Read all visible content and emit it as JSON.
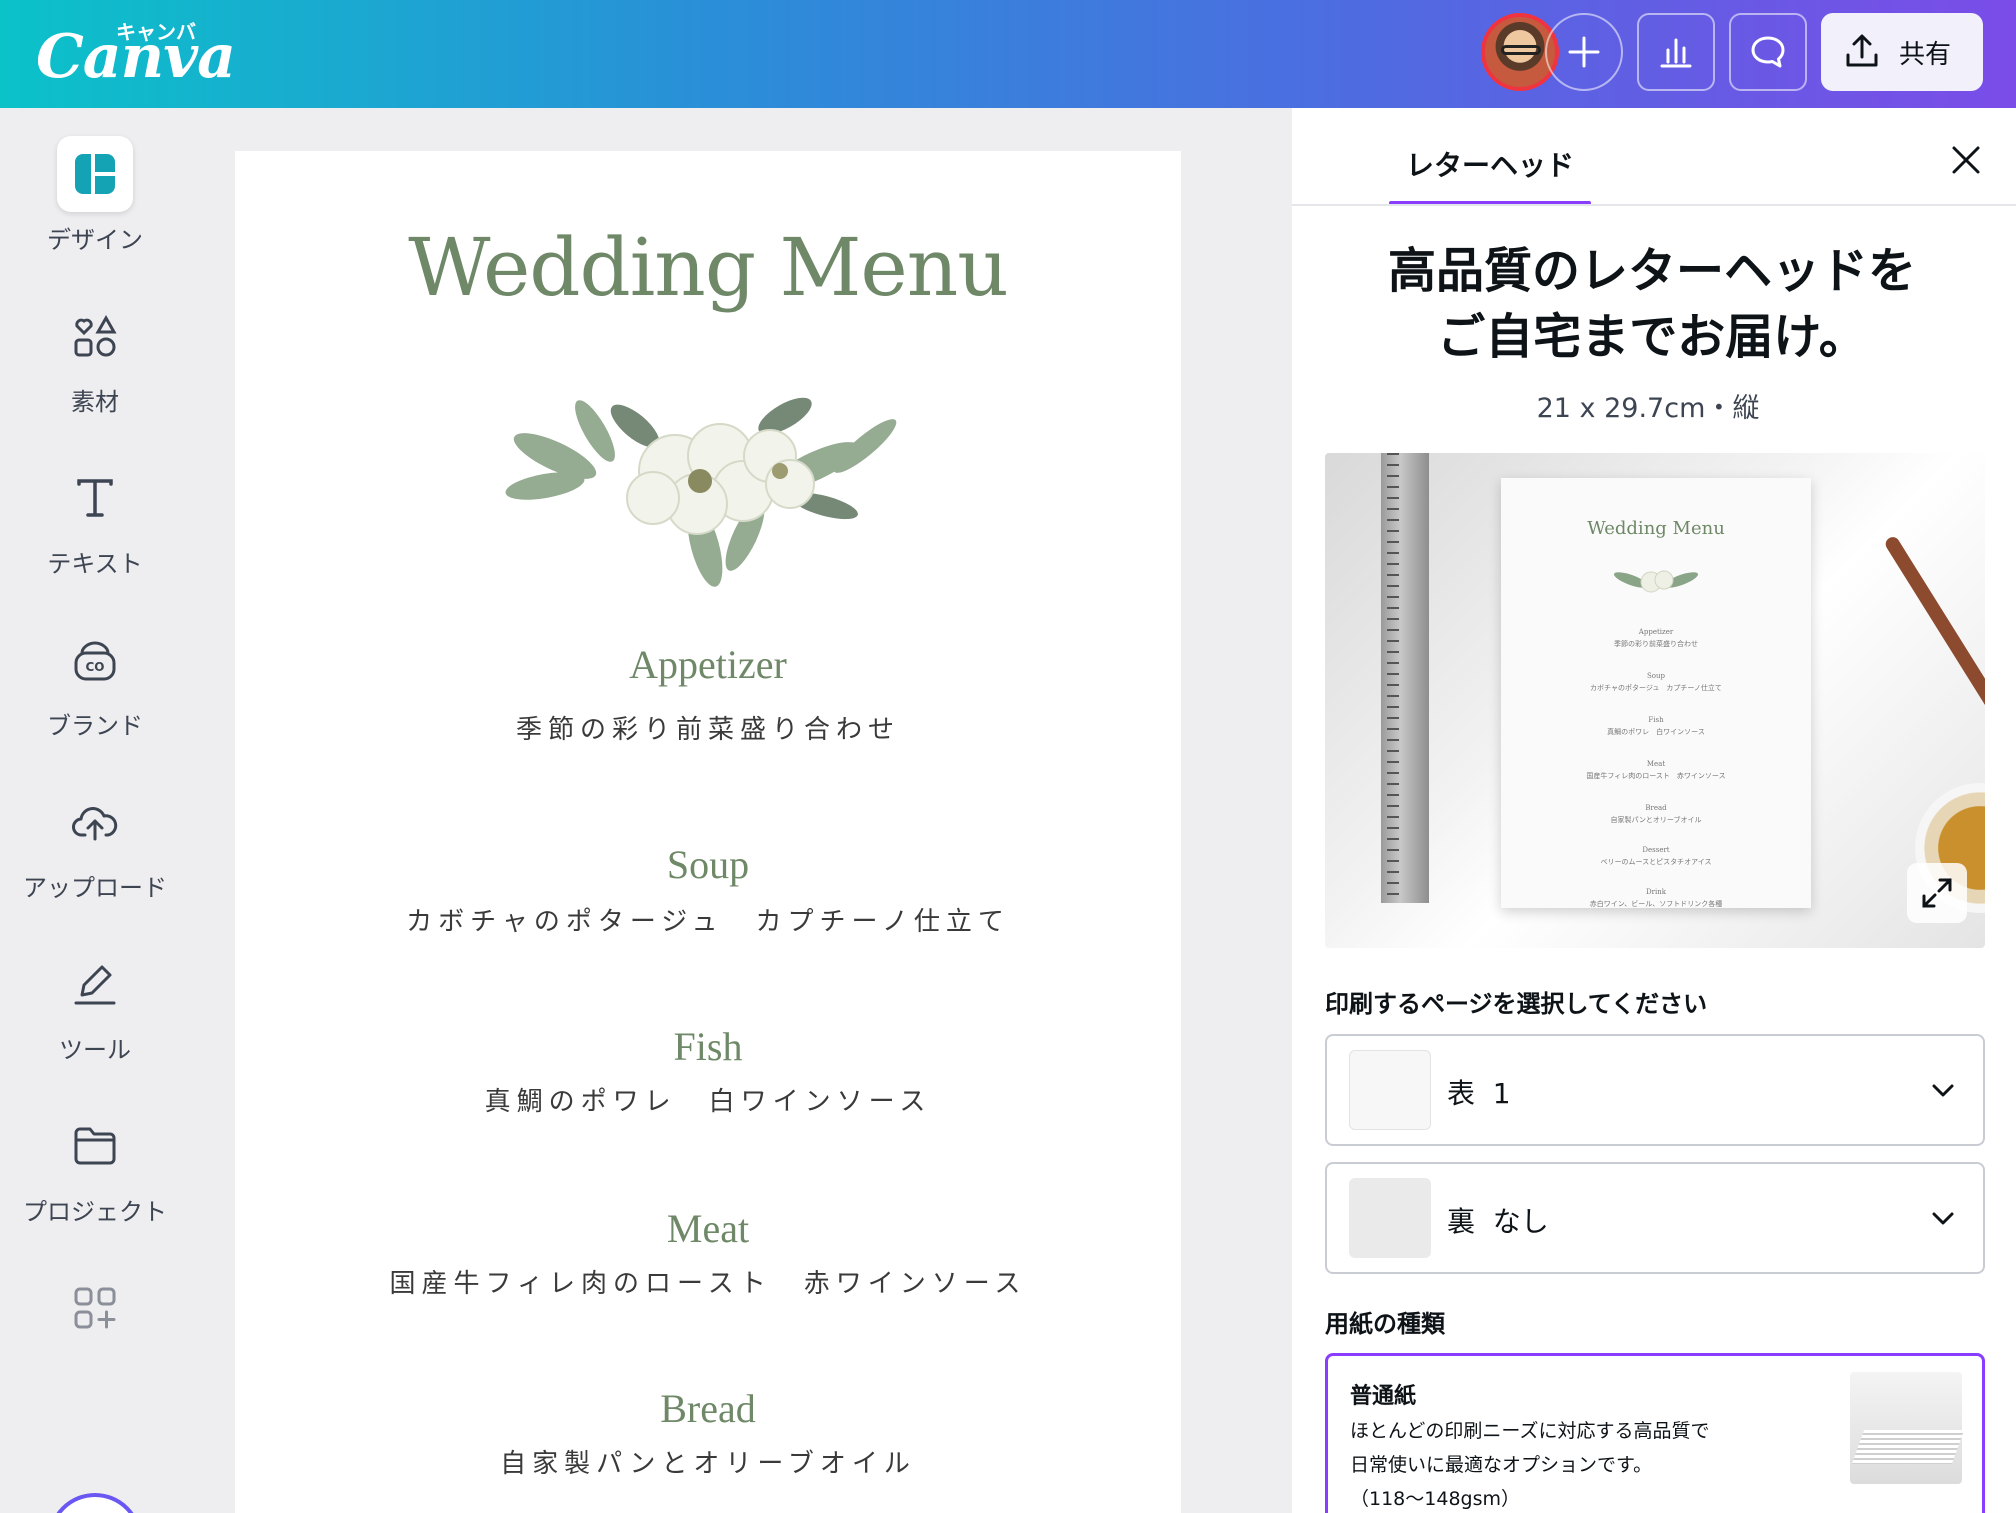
{
  "header": {
    "logo_text": "Canva",
    "logo_kana": "キャンバ",
    "share_label": "共有"
  },
  "sidebar": {
    "items": [
      {
        "label": "デザイン",
        "icon": "design-icon"
      },
      {
        "label": "素材",
        "icon": "elements-icon"
      },
      {
        "label": "テキスト",
        "icon": "text-icon"
      },
      {
        "label": "ブランド",
        "icon": "brand-icon"
      },
      {
        "label": "アップロード",
        "icon": "upload-icon"
      },
      {
        "label": "ツール",
        "icon": "tools-icon"
      },
      {
        "label": "プロジェクト",
        "icon": "projects-icon"
      },
      {
        "label": "",
        "icon": "apps-icon"
      }
    ]
  },
  "document": {
    "title": "Wedding Menu",
    "courses": [
      {
        "name": "Appetizer",
        "desc": "季節の彩り前菜盛り合わせ"
      },
      {
        "name": "Soup",
        "desc": "カボチャのポタージュ　カプチーノ仕立て"
      },
      {
        "name": "Fish",
        "desc": "真鯛のポワレ　白ワインソース"
      },
      {
        "name": "Meat",
        "desc": "国産牛フィレ肉のロースト　赤ワインソース"
      },
      {
        "name": "Bread",
        "desc": "自家製パンとオリーブオイル"
      }
    ]
  },
  "panel": {
    "tab_label": "レターヘッド",
    "headline_line1": "高品質のレターヘッドを",
    "headline_line2": "ご自宅までお届け。",
    "dimensions": "21 x 29.7cm・縦",
    "preview": {
      "title": "Wedding Menu",
      "rows": [
        {
          "name": "Appetizer",
          "desc": "季節の彩り前菜盛り合わせ"
        },
        {
          "name": "Soup",
          "desc": "カボチャのポタージュ　カプチーノ仕立て"
        },
        {
          "name": "Fish",
          "desc": "真鯛のポワレ　白ワインソース"
        },
        {
          "name": "Meat",
          "desc": "国産牛フィレ肉のロースト　赤ワインソース"
        },
        {
          "name": "Bread",
          "desc": "自家製パンとオリーブオイル"
        },
        {
          "name": "Dessert",
          "desc": "ベリーのムースとピスタチオアイス"
        },
        {
          "name": "Drink",
          "desc": "赤白ワイン、ビール、ソフトドリンク各種"
        }
      ]
    },
    "pages_label": "印刷するページを選択してください",
    "front_select": "表  1",
    "back_select": "裏  なし",
    "paper_label": "用紙の種類",
    "paper_option": {
      "name": "普通紙",
      "desc_line1": "ほとんどの印刷ニーズに対応する高品質で",
      "desc_line2": "日常使いに最適なオプションです。",
      "desc_line3": "（118〜148gsm）"
    }
  },
  "colors": {
    "accent": "#8b3dff",
    "menu_green": "#6f8868",
    "gradient_start": "#0bc2c9",
    "gradient_end": "#7b4ce8"
  }
}
